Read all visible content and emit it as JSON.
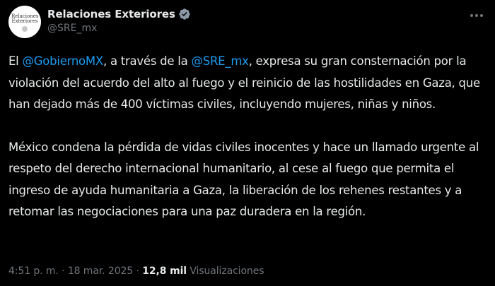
{
  "account": {
    "display_name": "Relaciones Exteriores",
    "handle": "@SRE_mx",
    "avatar_text": "Relaciones Exteriores",
    "verified_icon": "verified-badge-icon",
    "verified_color": "#8b98a5"
  },
  "menu": {
    "icon": "more-options-icon"
  },
  "tweet": {
    "p1": {
      "t1": "El ",
      "m1": "@GobiernoMX",
      "t2": ", a través de la ",
      "m2": "@SRE_mx",
      "t3": ", expresa su gran consternación por la violación del acuerdo del alto al fuego y el reinicio de las hostilidades en Gaza, que han dejado más de 400 víctimas civiles, incluyendo mujeres, niñas y niños."
    },
    "p2": "México condena la pérdida de vidas civiles inocentes y hace un llamado urgente al respeto del derecho internacional humanitario, al cese al fuego que permita el ingreso de ayuda humanitaria a Gaza, la liberación de los rehenes restantes y a retomar las negociaciones para una paz duradera en la región."
  },
  "meta": {
    "time": "4:51 p. m.",
    "separator": " · ",
    "date": "18 mar. 2025",
    "views_count": "12,8 mil",
    "views_label": "Visualizaciones"
  },
  "colors": {
    "background": "#000000",
    "text": "#e7e9ea",
    "secondary": "#71767b",
    "link": "#1d9bf0"
  }
}
